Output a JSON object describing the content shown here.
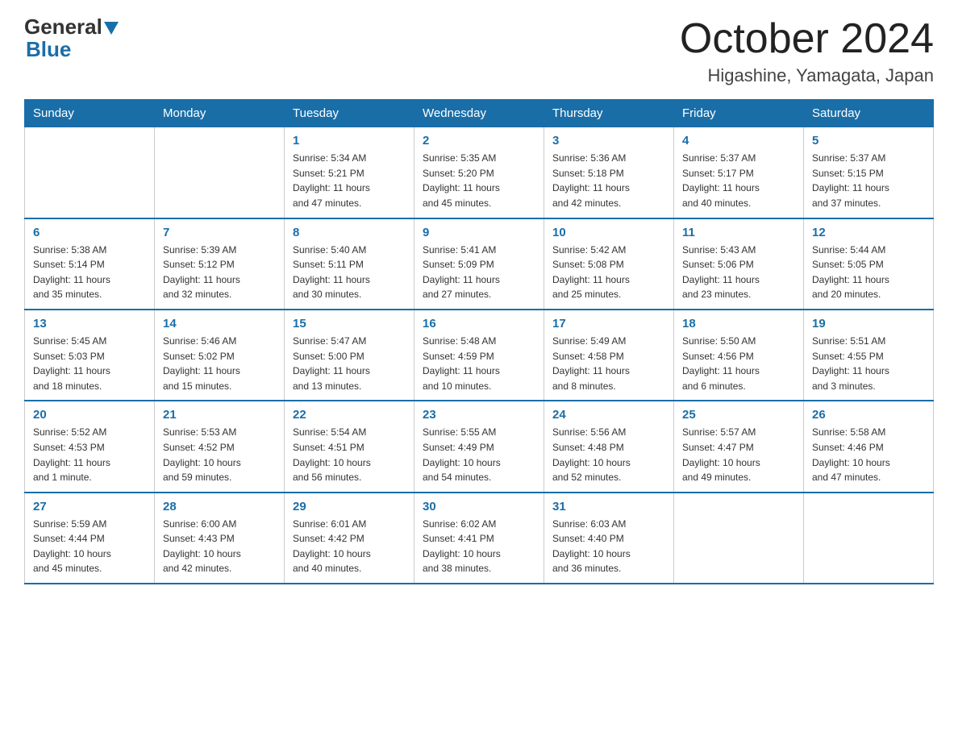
{
  "logo": {
    "general": "General",
    "blue": "Blue"
  },
  "title": "October 2024",
  "location": "Higashine, Yamagata, Japan",
  "headers": [
    "Sunday",
    "Monday",
    "Tuesday",
    "Wednesday",
    "Thursday",
    "Friday",
    "Saturday"
  ],
  "weeks": [
    [
      {
        "day": "",
        "info": ""
      },
      {
        "day": "",
        "info": ""
      },
      {
        "day": "1",
        "info": "Sunrise: 5:34 AM\nSunset: 5:21 PM\nDaylight: 11 hours\nand 47 minutes."
      },
      {
        "day": "2",
        "info": "Sunrise: 5:35 AM\nSunset: 5:20 PM\nDaylight: 11 hours\nand 45 minutes."
      },
      {
        "day": "3",
        "info": "Sunrise: 5:36 AM\nSunset: 5:18 PM\nDaylight: 11 hours\nand 42 minutes."
      },
      {
        "day": "4",
        "info": "Sunrise: 5:37 AM\nSunset: 5:17 PM\nDaylight: 11 hours\nand 40 minutes."
      },
      {
        "day": "5",
        "info": "Sunrise: 5:37 AM\nSunset: 5:15 PM\nDaylight: 11 hours\nand 37 minutes."
      }
    ],
    [
      {
        "day": "6",
        "info": "Sunrise: 5:38 AM\nSunset: 5:14 PM\nDaylight: 11 hours\nand 35 minutes."
      },
      {
        "day": "7",
        "info": "Sunrise: 5:39 AM\nSunset: 5:12 PM\nDaylight: 11 hours\nand 32 minutes."
      },
      {
        "day": "8",
        "info": "Sunrise: 5:40 AM\nSunset: 5:11 PM\nDaylight: 11 hours\nand 30 minutes."
      },
      {
        "day": "9",
        "info": "Sunrise: 5:41 AM\nSunset: 5:09 PM\nDaylight: 11 hours\nand 27 minutes."
      },
      {
        "day": "10",
        "info": "Sunrise: 5:42 AM\nSunset: 5:08 PM\nDaylight: 11 hours\nand 25 minutes."
      },
      {
        "day": "11",
        "info": "Sunrise: 5:43 AM\nSunset: 5:06 PM\nDaylight: 11 hours\nand 23 minutes."
      },
      {
        "day": "12",
        "info": "Sunrise: 5:44 AM\nSunset: 5:05 PM\nDaylight: 11 hours\nand 20 minutes."
      }
    ],
    [
      {
        "day": "13",
        "info": "Sunrise: 5:45 AM\nSunset: 5:03 PM\nDaylight: 11 hours\nand 18 minutes."
      },
      {
        "day": "14",
        "info": "Sunrise: 5:46 AM\nSunset: 5:02 PM\nDaylight: 11 hours\nand 15 minutes."
      },
      {
        "day": "15",
        "info": "Sunrise: 5:47 AM\nSunset: 5:00 PM\nDaylight: 11 hours\nand 13 minutes."
      },
      {
        "day": "16",
        "info": "Sunrise: 5:48 AM\nSunset: 4:59 PM\nDaylight: 11 hours\nand 10 minutes."
      },
      {
        "day": "17",
        "info": "Sunrise: 5:49 AM\nSunset: 4:58 PM\nDaylight: 11 hours\nand 8 minutes."
      },
      {
        "day": "18",
        "info": "Sunrise: 5:50 AM\nSunset: 4:56 PM\nDaylight: 11 hours\nand 6 minutes."
      },
      {
        "day": "19",
        "info": "Sunrise: 5:51 AM\nSunset: 4:55 PM\nDaylight: 11 hours\nand 3 minutes."
      }
    ],
    [
      {
        "day": "20",
        "info": "Sunrise: 5:52 AM\nSunset: 4:53 PM\nDaylight: 11 hours\nand 1 minute."
      },
      {
        "day": "21",
        "info": "Sunrise: 5:53 AM\nSunset: 4:52 PM\nDaylight: 10 hours\nand 59 minutes."
      },
      {
        "day": "22",
        "info": "Sunrise: 5:54 AM\nSunset: 4:51 PM\nDaylight: 10 hours\nand 56 minutes."
      },
      {
        "day": "23",
        "info": "Sunrise: 5:55 AM\nSunset: 4:49 PM\nDaylight: 10 hours\nand 54 minutes."
      },
      {
        "day": "24",
        "info": "Sunrise: 5:56 AM\nSunset: 4:48 PM\nDaylight: 10 hours\nand 52 minutes."
      },
      {
        "day": "25",
        "info": "Sunrise: 5:57 AM\nSunset: 4:47 PM\nDaylight: 10 hours\nand 49 minutes."
      },
      {
        "day": "26",
        "info": "Sunrise: 5:58 AM\nSunset: 4:46 PM\nDaylight: 10 hours\nand 47 minutes."
      }
    ],
    [
      {
        "day": "27",
        "info": "Sunrise: 5:59 AM\nSunset: 4:44 PM\nDaylight: 10 hours\nand 45 minutes."
      },
      {
        "day": "28",
        "info": "Sunrise: 6:00 AM\nSunset: 4:43 PM\nDaylight: 10 hours\nand 42 minutes."
      },
      {
        "day": "29",
        "info": "Sunrise: 6:01 AM\nSunset: 4:42 PM\nDaylight: 10 hours\nand 40 minutes."
      },
      {
        "day": "30",
        "info": "Sunrise: 6:02 AM\nSunset: 4:41 PM\nDaylight: 10 hours\nand 38 minutes."
      },
      {
        "day": "31",
        "info": "Sunrise: 6:03 AM\nSunset: 4:40 PM\nDaylight: 10 hours\nand 36 minutes."
      },
      {
        "day": "",
        "info": ""
      },
      {
        "day": "",
        "info": ""
      }
    ]
  ]
}
